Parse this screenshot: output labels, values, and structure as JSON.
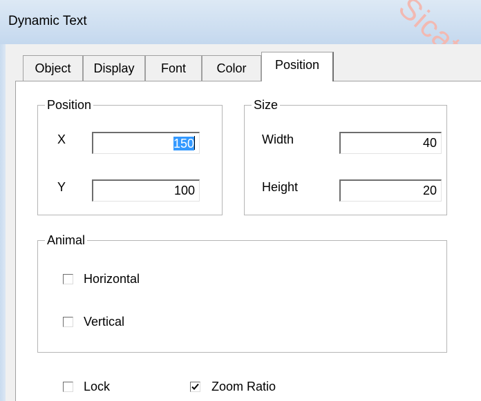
{
  "window": {
    "title": "Dynamic Text"
  },
  "tabs": [
    {
      "label": "Object",
      "active": false
    },
    {
      "label": "Display",
      "active": false
    },
    {
      "label": "Font",
      "active": false
    },
    {
      "label": "Color",
      "active": false
    },
    {
      "label": "Position",
      "active": true
    }
  ],
  "position_group": {
    "label": "Position",
    "x_label": "X",
    "x_value": "150",
    "y_label": "Y",
    "y_value": "100"
  },
  "size_group": {
    "label": "Size",
    "width_label": "Width",
    "width_value": "40",
    "height_label": "Height",
    "height_value": "20"
  },
  "animal_group": {
    "label": "Animal",
    "horizontal": {
      "label": "Horizontal",
      "checked": false
    },
    "vertical": {
      "label": "Vertical",
      "checked": false
    }
  },
  "options": {
    "lock": {
      "label": "Lock",
      "checked": false
    },
    "zoom_ratio": {
      "label": "Zoom Ratio",
      "checked": true
    }
  },
  "watermark": "Sicato",
  "colors": {
    "selection": "#3399ff",
    "titlebar": "#c4d8ee",
    "watermark": "#f2b9b2"
  }
}
